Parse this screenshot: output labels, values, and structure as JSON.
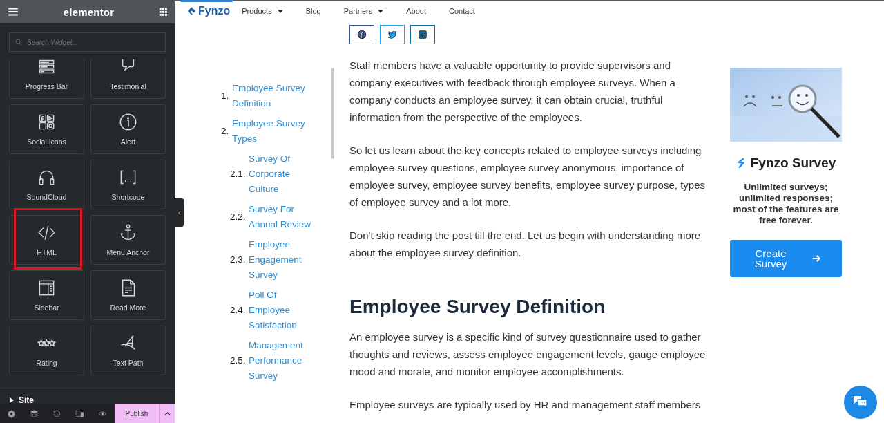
{
  "editor": {
    "brand": "elementor",
    "search": {
      "placeholder": "Search Widget..."
    },
    "widgets": [
      {
        "label": "Progress Bar",
        "highlighted": false
      },
      {
        "label": "Testimonial",
        "highlighted": false
      },
      {
        "label": "Social Icons",
        "highlighted": false
      },
      {
        "label": "Alert",
        "highlighted": false
      },
      {
        "label": "SoundCloud",
        "highlighted": false
      },
      {
        "label": "Shortcode",
        "highlighted": false
      },
      {
        "label": "HTML",
        "highlighted": true
      },
      {
        "label": "Menu Anchor",
        "highlighted": false
      },
      {
        "label": "Sidebar",
        "highlighted": false
      },
      {
        "label": "Read More",
        "highlighted": false
      },
      {
        "label": "Rating",
        "highlighted": false
      },
      {
        "label": "Text Path",
        "highlighted": false
      }
    ],
    "section": {
      "label": "Site",
      "expanded": false
    },
    "publish": "Publish"
  },
  "site": {
    "logo": "Fynzo",
    "nav": [
      {
        "label": "Products",
        "dropdown": true
      },
      {
        "label": "Blog",
        "dropdown": false
      },
      {
        "label": "Partners",
        "dropdown": true
      },
      {
        "label": "About",
        "dropdown": false
      },
      {
        "label": "Contact",
        "dropdown": false
      }
    ]
  },
  "toc": [
    {
      "number": "1.",
      "label": "Employee Survey Definition"
    },
    {
      "number": "2.",
      "label": "Employee Survey Types",
      "children": [
        {
          "number": "2.1.",
          "label": "Survey Of Corporate Culture"
        },
        {
          "number": "2.2.",
          "label": "Survey For Annual Review"
        },
        {
          "number": "2.3.",
          "label": "Employee Engagement Survey"
        },
        {
          "number": "2.4.",
          "label": "Poll Of Employee Satisfaction"
        },
        {
          "number": "2.5.",
          "label": "Management Performance Survey"
        }
      ]
    }
  ],
  "article": {
    "intro": [
      "Staff members have a valuable opportunity to provide supervisors and company executives with feedback through employee surveys. When a company conducts an employee survey, it can obtain crucial, truthful information from the perspective of the employees.",
      "So let us learn about the key concepts related to employee surveys including employee survey questions, employee survey anonymous, importance of employee survey, employee survey benefits, employee survey purpose, types of employee survey and a lot more.",
      "Don't skip reading the post till the end. Let us begin with understanding more about the employee survey definition."
    ],
    "heading": "Employee Survey Definition",
    "body": [
      "An employee survey is a specific kind of survey questionnaire used to gather thoughts and reviews, assess employee engagement levels, gauge employee mood and morale, and monitor employee accomplishments.",
      "Employee surveys are typically used by HR and management staff members"
    ]
  },
  "promo": {
    "title": "Fynzo Survey",
    "text": "Unlimited surveys; unlimited responses; most of the features are free forever.",
    "button": "Create Survey"
  }
}
